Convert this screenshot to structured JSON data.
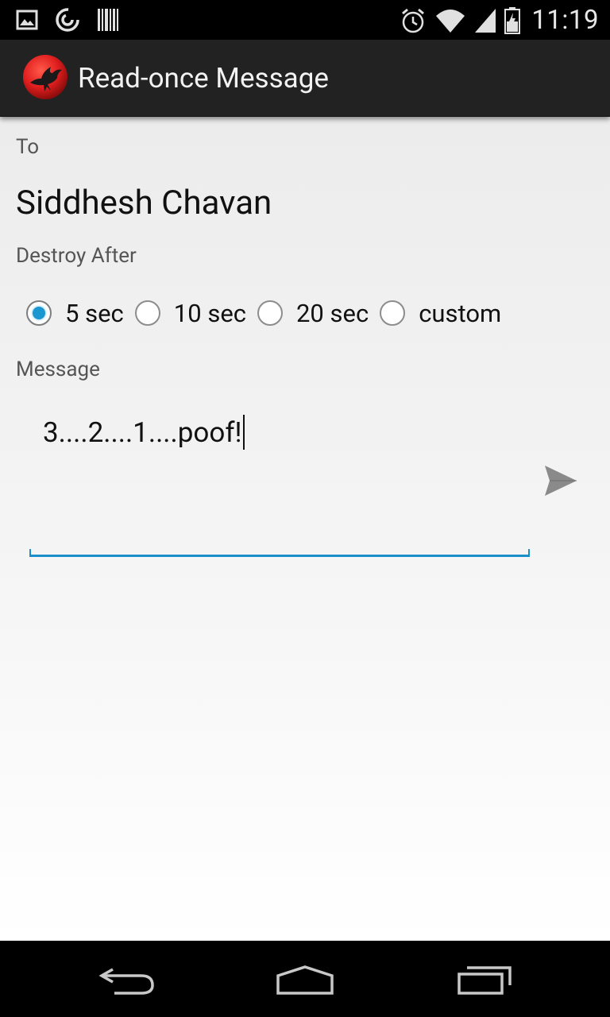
{
  "status_bar": {
    "time": "11:19",
    "left_icons": [
      "image-notification-icon",
      "sync-notification-icon",
      "barcode-notification-icon"
    ],
    "right_icons": [
      "alarm-icon",
      "wifi-icon",
      "cell-signal-icon",
      "battery-icon"
    ]
  },
  "action_bar": {
    "title": "Read-once Message",
    "icon": "app-bird-icon"
  },
  "form": {
    "to_label": "To",
    "recipient": "Siddhesh Chavan",
    "destroy_label": "Destroy After",
    "destroy_options": [
      {
        "label": "5 sec",
        "checked": true
      },
      {
        "label": "10 sec",
        "checked": false
      },
      {
        "label": "20 sec",
        "checked": false
      },
      {
        "label": "custom",
        "checked": false
      }
    ],
    "message_label": "Message",
    "message_value": "3....2....1....poof!"
  },
  "colors": {
    "accent": "#1897d1",
    "action_bar": "#222222",
    "app_icon": "#e01e1e"
  },
  "nav_bar": {
    "buttons": [
      "back-icon",
      "home-icon",
      "recents-icon"
    ]
  }
}
